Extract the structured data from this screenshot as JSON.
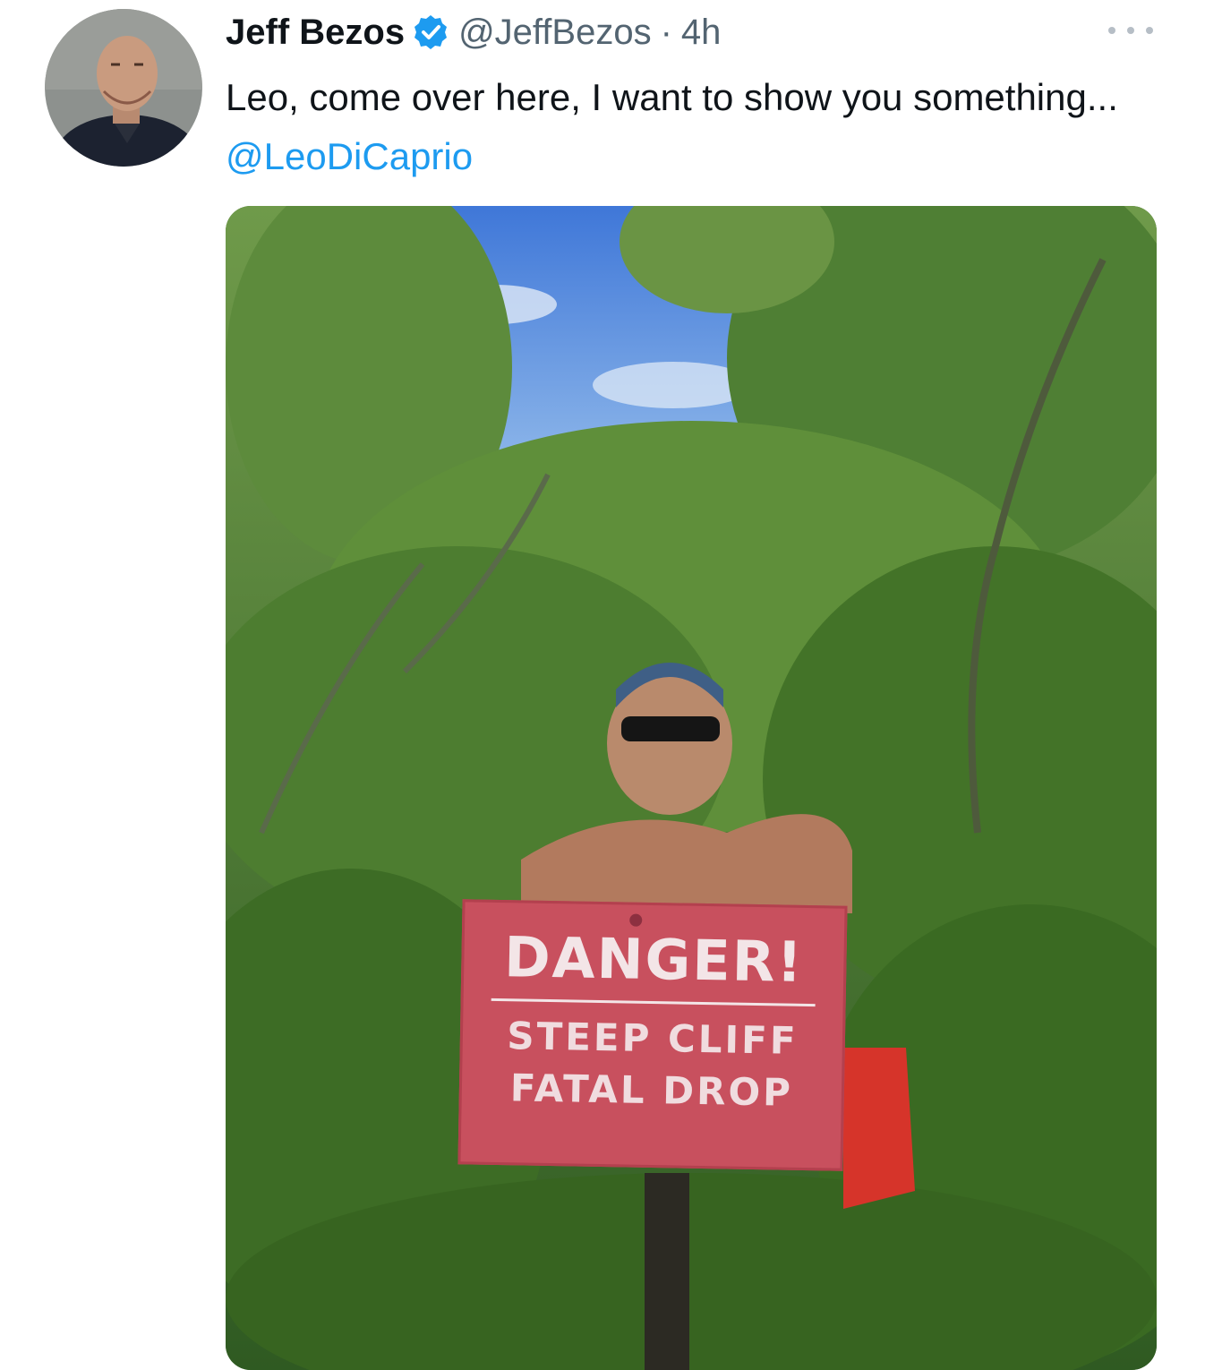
{
  "tweet": {
    "author": {
      "display_name": "Jeff Bezos",
      "handle": "@JeffBezos",
      "verified": true,
      "avatar_icon": "profile-photo"
    },
    "separator": "·",
    "timestamp": "4h",
    "more_icon": "more-dots-icon",
    "text_plain": "Leo, come over here, I want to show you something...",
    "mention": "@LeoDiCaprio",
    "colors": {
      "mention": "#1d9bf0",
      "verified_badge": "#1d9bf0",
      "secondary_text": "#536471"
    },
    "media": {
      "sign": {
        "line1": "DANGER!",
        "line2": "STEEP CLIFF",
        "line3": "FATAL DROP"
      }
    }
  }
}
